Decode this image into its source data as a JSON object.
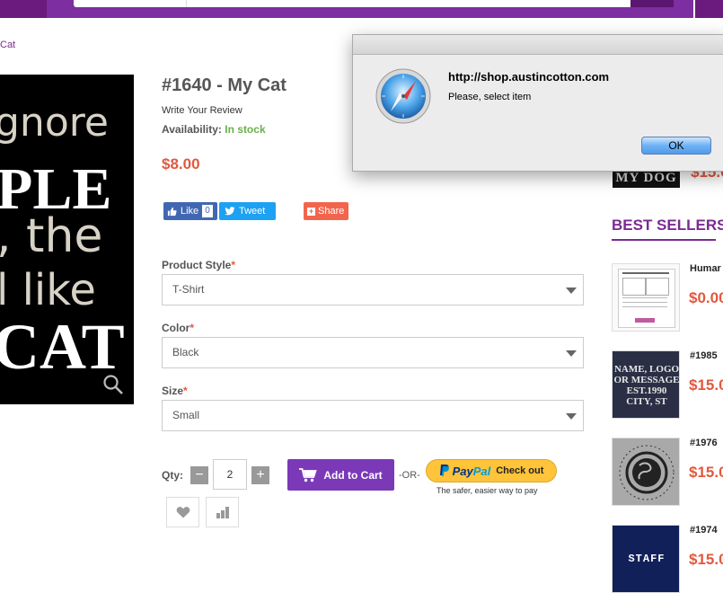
{
  "breadcrumb": "Cat",
  "product": {
    "image_lines": [
      "gnore",
      "PLE",
      ", the",
      "l like",
      "CAT"
    ],
    "title": "#1640 - My Cat",
    "write_review": "Write Your Review",
    "availability_label": "Availability:",
    "availability_value": "In stock",
    "price": "$8.00"
  },
  "social": {
    "like_label": "Like",
    "like_count": "0",
    "tweet_label": "Tweet",
    "share_label": "Share"
  },
  "options": {
    "style_label": "Product Style",
    "style_value": "T-Shirt",
    "color_label": "Color",
    "color_value": "Black",
    "size_label": "Size",
    "size_value": "Small",
    "required_mark": "*"
  },
  "purchase": {
    "qty_label": "Qty:",
    "qty_minus": "−",
    "qty_value": "2",
    "qty_plus": "+",
    "add_to_cart": "Add to Cart",
    "or": "-OR-",
    "paypal_p1": "Pay",
    "paypal_p2": "Pal",
    "paypal_checkout": "Check out",
    "paypal_tagline": "The safer, easier way to pay"
  },
  "sidebar": {
    "top_item_image_text": "MY DOG",
    "top_item_price": "$15.0",
    "best_sellers_title": "BEST SELLERS",
    "items": [
      {
        "name": "Humar",
        "price": "$0.00",
        "image_text": ""
      },
      {
        "name": "#1985",
        "price": "$15.0",
        "image_text": "NAME, LOGO OR MESSAGE EST.1990 CITY, ST"
      },
      {
        "name": "#1976",
        "price": "$15.0",
        "image_text": ""
      },
      {
        "name": "#1974",
        "price": "$15.0",
        "image_text": "STAFF"
      }
    ]
  },
  "dialog": {
    "host": "http://shop.austincotton.com",
    "message": "Please, select item",
    "ok_label": "OK"
  },
  "colors": {
    "brand_purple": "#7b2a93",
    "price_red": "#e2583e",
    "in_stock_green": "#6ab04c",
    "add_to_cart_purple": "#7b39b8"
  }
}
